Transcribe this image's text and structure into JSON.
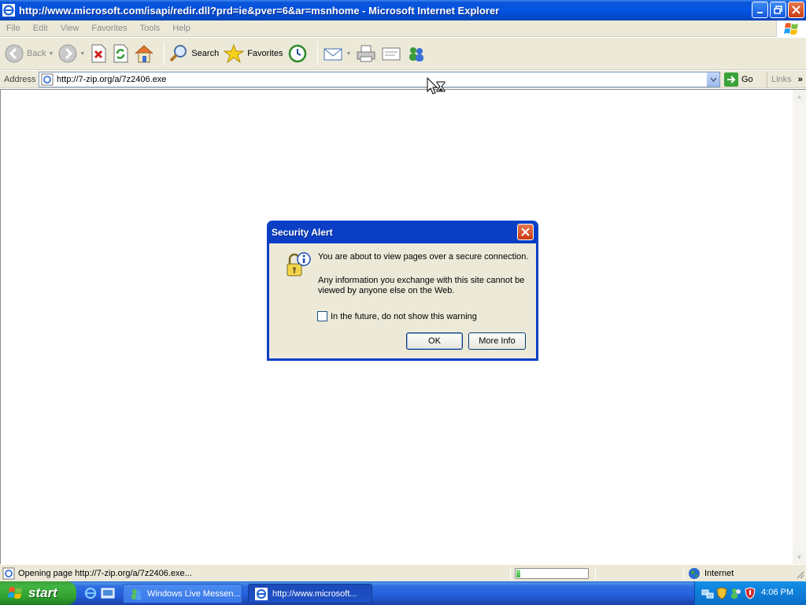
{
  "window": {
    "title": "http://www.microsoft.com/isapi/redir.dll?prd=ie&pver=6&ar=msnhome - Microsoft Internet Explorer"
  },
  "menu": [
    "File",
    "Edit",
    "View",
    "Favorites",
    "Tools",
    "Help"
  ],
  "toolbar": {
    "back_label": "Back",
    "search_label": "Search",
    "favorites_label": "Favorites"
  },
  "address": {
    "label": "Address",
    "url": "http://7-zip.org/a/7z2406.exe",
    "go_label": "Go",
    "links_label": "Links"
  },
  "dialog": {
    "title": "Security Alert",
    "message_1": "You are about to view pages over a secure connection.",
    "message_2": "Any information you exchange with this site cannot be viewed by anyone else on the Web.",
    "checkbox_label": "In the future, do not show this warning",
    "checkbox_checked": false,
    "ok_label": "OK",
    "more_info_label": "More Info"
  },
  "status": {
    "text": "Opening page http://7-zip.org/a/7z2406.exe...",
    "progress": 0.06,
    "zone": "Internet"
  },
  "taskbar": {
    "start_label": "start",
    "tasks": [
      {
        "label": "Windows Live Messen...",
        "active": false
      },
      {
        "label": "http://www.microsoft...",
        "active": true
      }
    ],
    "clock": "4:06 PM"
  },
  "colors": {
    "title_blue": "#0453e3",
    "face": "#ece9d8",
    "start_green": "#3c9e3c"
  }
}
